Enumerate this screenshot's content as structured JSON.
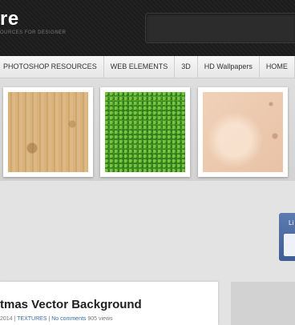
{
  "header": {
    "logo_text": "re",
    "tagline": "OURCES FOR DESIGNER"
  },
  "nav": {
    "items": [
      {
        "label": "PHOTOSHOP RESOURCES"
      },
      {
        "label": "WEB ELEMENTS"
      },
      {
        "label": "3D"
      },
      {
        "label": "HD Wallpapers"
      },
      {
        "label": "HOME"
      }
    ]
  },
  "featured": {
    "thumbnails": [
      {
        "name": "wood-texture"
      },
      {
        "name": "grass-texture"
      },
      {
        "name": "paper-texture"
      }
    ]
  },
  "social": {
    "label": "Li"
  },
  "post": {
    "title": "tmas Vector Background",
    "date_fragment": " 2014",
    "separator1": " | ",
    "category": "TEXTURES",
    "separator2": " | ",
    "comments": "No comments",
    "views": " 905 views"
  }
}
